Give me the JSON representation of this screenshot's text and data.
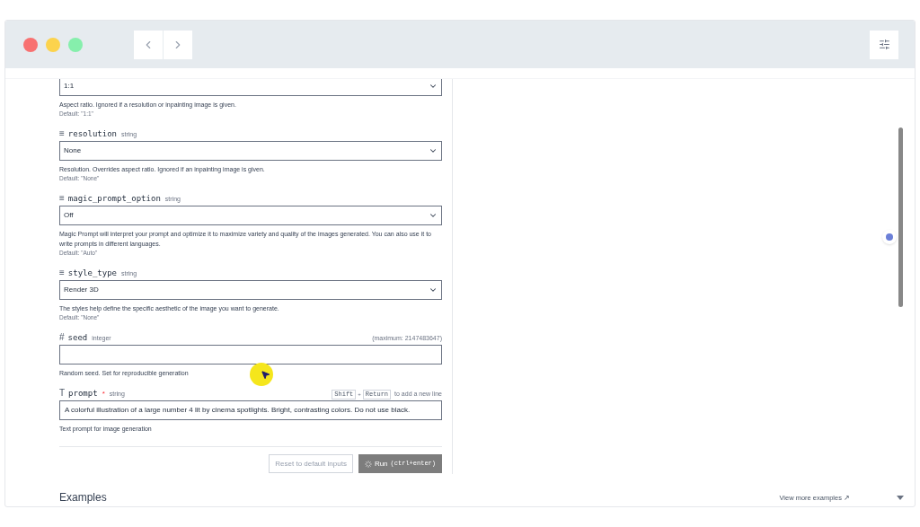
{
  "toolbar": {
    "traffic_lights": [
      {
        "color": "#f87171"
      },
      {
        "color": "#fcd34d"
      },
      {
        "color": "#86efac"
      }
    ]
  },
  "fields": [
    {
      "kind": "select",
      "value": "1:1",
      "description": "Aspect ratio. Ignored if a resolution or inpainting image is given.",
      "default": "Default: \"1:1\""
    },
    {
      "kind": "select",
      "icon": "≡",
      "name": "resolution",
      "type": "string",
      "value": "None",
      "description": "Resolution. Overrides aspect ratio. Ignored if an inpainting image is given.",
      "default": "Default: \"None\""
    },
    {
      "kind": "select",
      "icon": "≡",
      "name": "magic_prompt_option",
      "type": "string",
      "value": "Off",
      "description": "Magic Prompt will interpret your prompt and optimize it to maximize variety and quality of the images generated. You can also use it to write prompts in different languages.",
      "default": "Default: \"Auto\""
    },
    {
      "kind": "select",
      "icon": "≡",
      "name": "style_type",
      "type": "string",
      "value": "Render 3D",
      "description": "The styles help define the specific aesthetic of the image you want to generate.",
      "default": "Default: \"None\""
    },
    {
      "kind": "input",
      "icon": "#",
      "name": "seed",
      "type": "integer",
      "hint": "(maximum: 2147483647)",
      "description": "Random seed. Set for reproducible generation"
    },
    {
      "kind": "input",
      "icon": "T",
      "name": "prompt",
      "required": "*",
      "type": "string",
      "keys": [
        "Shift",
        "+",
        "Return"
      ],
      "hint": "to add a new line",
      "value": "A colorful illustration of a large number 4 lit by cinema spotlights. Bright, contrasting colors. Do not use black.",
      "description": "Text prompt for image generation"
    }
  ],
  "actions": {
    "reset": "Reset to default inputs",
    "run": "Run",
    "run_shortcut": "(ctrl+enter)"
  },
  "examples": {
    "title": "Examples",
    "link": "View more examples ↗"
  }
}
